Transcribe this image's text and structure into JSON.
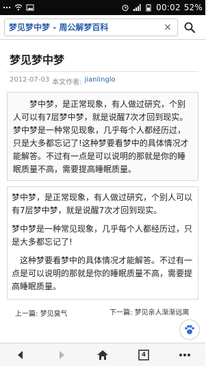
{
  "status_bar": {
    "time": "00:02",
    "battery": "52%",
    "icons": [
      "dots-icon",
      "wifi-icon",
      "image-icon",
      "alarm-icon",
      "signal-icon",
      "battery-icon"
    ]
  },
  "browser": {
    "url_text": "梦见梦中梦 - 周公解梦百科",
    "clear_symbol": "×"
  },
  "article": {
    "title": "梦见梦中梦",
    "date": "2012-07-03",
    "author_label": "本文作者:",
    "author": "jianlinglo",
    "summary": "梦中梦，是正常现象，有人做过研究，个别人可以有7层梦中梦，就是说醒7次才回到现实。梦中梦是一种常见现象，几乎每个人都经历过，只是大多都忘记了!这种梦要看梦中的具体情况才能解答。不过有一点是可以说明的那就是你的睡眠质量不高，需要提高睡眠质量。",
    "paragraphs": [
      "梦中梦，是正常现象，有人做过研究，个别人可以有7层梦中梦，就是说醒7次才回到现实。",
      "梦中梦是一种常见现象，几乎每个人都经历过，只是大多都忘记了!",
      "这种梦要看梦中的具体情况才能解答。不过有一点是可以说明的那就是你的睡眠质量不高，需要提高睡眠质量。"
    ]
  },
  "navigation": {
    "prev_label": "上一篇:",
    "prev_title": "梦见臭气",
    "next_label": "下一篇:",
    "next_title": "梦见亲人渐渐远离"
  },
  "toolbar": {
    "tab_count": "4",
    "icons": [
      "back-icon",
      "forward-icon",
      "home-icon",
      "tabs-icon",
      "menu-icon"
    ]
  }
}
